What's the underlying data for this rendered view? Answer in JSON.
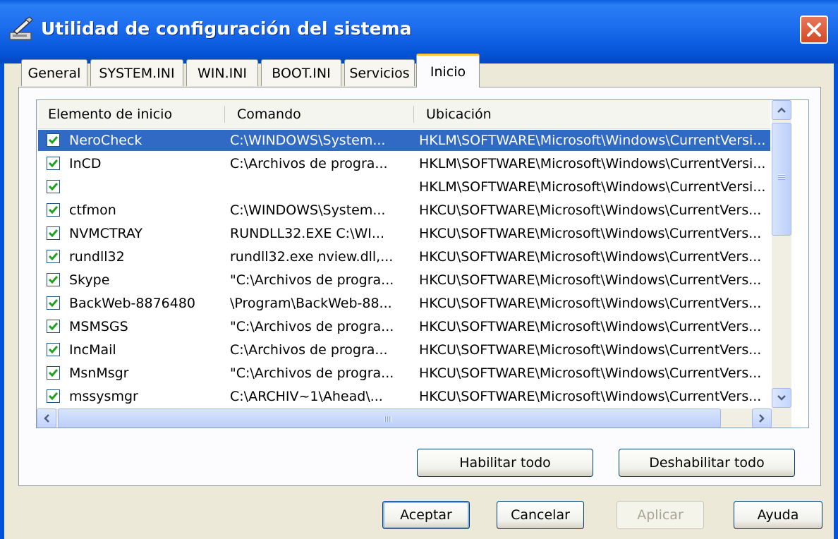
{
  "window": {
    "title": "Utilidad de configuración del sistema"
  },
  "tabs": [
    {
      "label": "General"
    },
    {
      "label": "SYSTEM.INI"
    },
    {
      "label": "WIN.INI"
    },
    {
      "label": "BOOT.INI"
    },
    {
      "label": "Servicios"
    },
    {
      "label": "Inicio",
      "active": true
    }
  ],
  "list": {
    "columns": [
      "Elemento de inicio",
      "Comando",
      "Ubicación"
    ],
    "rows": [
      {
        "checked": true,
        "selected": true,
        "name": "NeroCheck",
        "command": "C:\\WINDOWS\\System...",
        "location": "HKLM\\SOFTWARE\\Microsoft\\Windows\\CurrentVersi..."
      },
      {
        "checked": true,
        "name": "InCD",
        "command": "C:\\Archivos de progra...",
        "location": "HKLM\\SOFTWARE\\Microsoft\\Windows\\CurrentVersi..."
      },
      {
        "checked": true,
        "name": "",
        "command": "",
        "location": "HKLM\\SOFTWARE\\Microsoft\\Windows\\CurrentVersi..."
      },
      {
        "checked": true,
        "name": "ctfmon",
        "command": "C:\\WINDOWS\\System...",
        "location": "HKCU\\SOFTWARE\\Microsoft\\Windows\\CurrentVers..."
      },
      {
        "checked": true,
        "name": "NVMCTRAY",
        "command": "RUNDLL32.EXE C:\\WI...",
        "location": "HKCU\\SOFTWARE\\Microsoft\\Windows\\CurrentVers..."
      },
      {
        "checked": true,
        "name": "rundll32",
        "command": "rundll32.exe nview.dll,...",
        "location": "HKCU\\SOFTWARE\\Microsoft\\Windows\\CurrentVers..."
      },
      {
        "checked": true,
        "name": "Skype",
        "command": "\"C:\\Archivos de progra...",
        "location": "HKCU\\SOFTWARE\\Microsoft\\Windows\\CurrentVers..."
      },
      {
        "checked": true,
        "name": "BackWeb-8876480",
        "command": "\\Program\\BackWeb-88...",
        "location": "HKCU\\SOFTWARE\\Microsoft\\Windows\\CurrentVers..."
      },
      {
        "checked": true,
        "name": "MSMSGS",
        "command": "\"C:\\Archivos de progra...",
        "location": "HKCU\\SOFTWARE\\Microsoft\\Windows\\CurrentVers..."
      },
      {
        "checked": true,
        "name": "IncMail",
        "command": "C:\\Archivos de progra...",
        "location": "HKCU\\SOFTWARE\\Microsoft\\Windows\\CurrentVers..."
      },
      {
        "checked": true,
        "name": "MsnMsgr",
        "command": "\"C:\\Archivos de progra...",
        "location": "HKCU\\SOFTWARE\\Microsoft\\Windows\\CurrentVers..."
      },
      {
        "checked": true,
        "name": "mssysmgr",
        "command": "C:\\ARCHIV~1\\Ahead\\...",
        "location": "HKCU\\SOFTWARE\\Microsoft\\Windows\\CurrentVers..."
      }
    ]
  },
  "panel_buttons": {
    "enable_all": "Habilitar todo",
    "disable_all": "Deshabilitar todo"
  },
  "dialog_buttons": {
    "ok": "Aceptar",
    "cancel": "Cancelar",
    "apply": "Aplicar",
    "help": "Ayuda"
  },
  "colors": {
    "titlebar": "#0453d6",
    "selection": "#316ac5",
    "check": "#21a121",
    "active_tab_accent": "#ffc73c"
  }
}
